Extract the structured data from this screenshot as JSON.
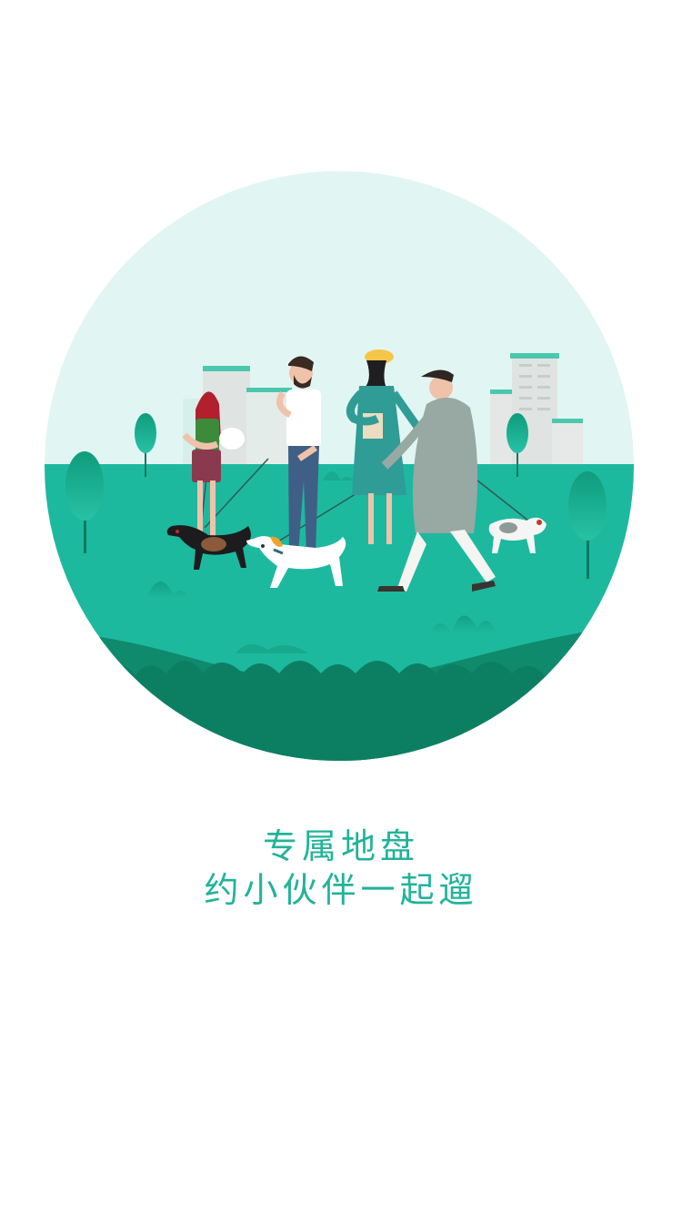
{
  "onboarding": {
    "illustration_icon": "people-walking-dogs-in-park-illustration",
    "caption_line1": "专属地盘",
    "caption_line2": "约小伙伴一起遛"
  },
  "colors": {
    "accent": "#22b39a",
    "sky": "#e1f6f2",
    "grass": "#1db99f",
    "grass_dark": "#0f8a6c"
  }
}
